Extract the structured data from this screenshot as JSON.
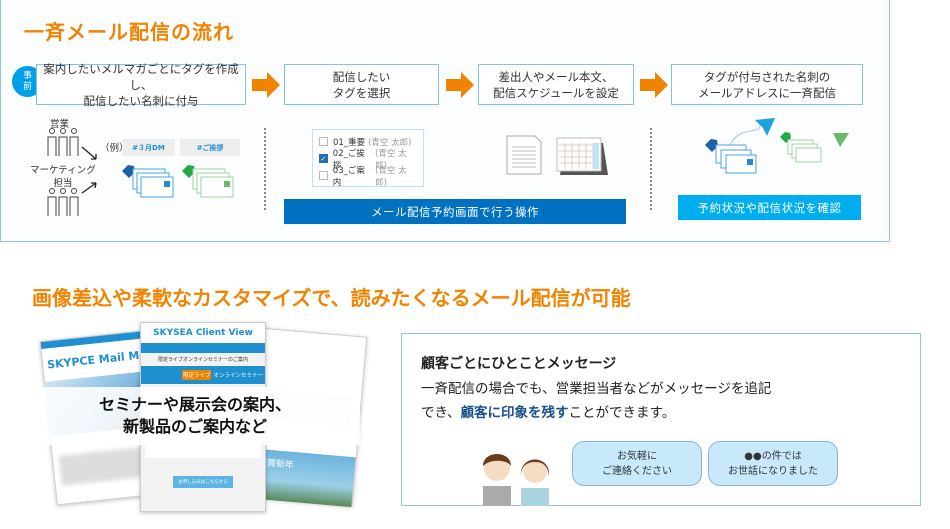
{
  "flow": {
    "title": "一斉メール配信の流れ",
    "pre_badge": "事\n前",
    "steps": [
      "案内したいメルマガごとにタグを作成し、\n配信したい名刺に付与",
      "配信したい\nタグを選択",
      "差出人やメール本文、\n配信スケジュールを設定",
      "タグが付与された名刺の\nメールアドレスに一斉配信"
    ],
    "groups": [
      "営業",
      "マーケティング\n担当"
    ],
    "example_label": "（例）",
    "tags": [
      "#３月DM",
      "#ご挨拶"
    ],
    "tag_list": [
      {
        "name": "01_重要",
        "owner": "(青空 太郎)",
        "checked": false
      },
      {
        "name": "02_ご挨拶",
        "owner": "(青空 太郎)",
        "checked": true
      },
      {
        "name": "03_ご案内",
        "owner": "(青空 太郎)",
        "checked": false
      }
    ],
    "operation_bar": "メール配信予約画面で行う操作",
    "status_bar": "予約状況や配信状況を確認",
    "colors": {
      "accent": "#f08300",
      "operation": "#0070c0",
      "status": "#00aeef",
      "blue_tag": "#1f5fa8",
      "green_tag": "#22a845"
    }
  },
  "custom": {
    "title": "画像差込や柔軟なカスタマイズで、読みたくなるメール配信が可能",
    "overlay": "セミナーや展示会の案内、\n新製品のご案内など",
    "mail_logos": [
      "SKYPCE Mail Mag",
      "SKYSEA Client View"
    ],
    "mail_subject": "限定ライブオンラインセミナーのご案内",
    "mail_banner_tag": "限定ライブ",
    "mail_banner_text": "オンラインセミナー",
    "mail_button": "お申し込みはこちらから",
    "new_year": "謹賀新年"
  },
  "message": {
    "heading": "顧客ごとにひとことメッセージ",
    "body_1": "一斉配信の場合でも、営業担当者などがメッセージを追記",
    "body_2a": "でき、",
    "body_highlight": "顧客に印象を残す",
    "body_2b": "ことができます。",
    "bubbles": [
      "お気軽に\nご連絡ください",
      "●●の件では\nお世話になりました"
    ]
  }
}
